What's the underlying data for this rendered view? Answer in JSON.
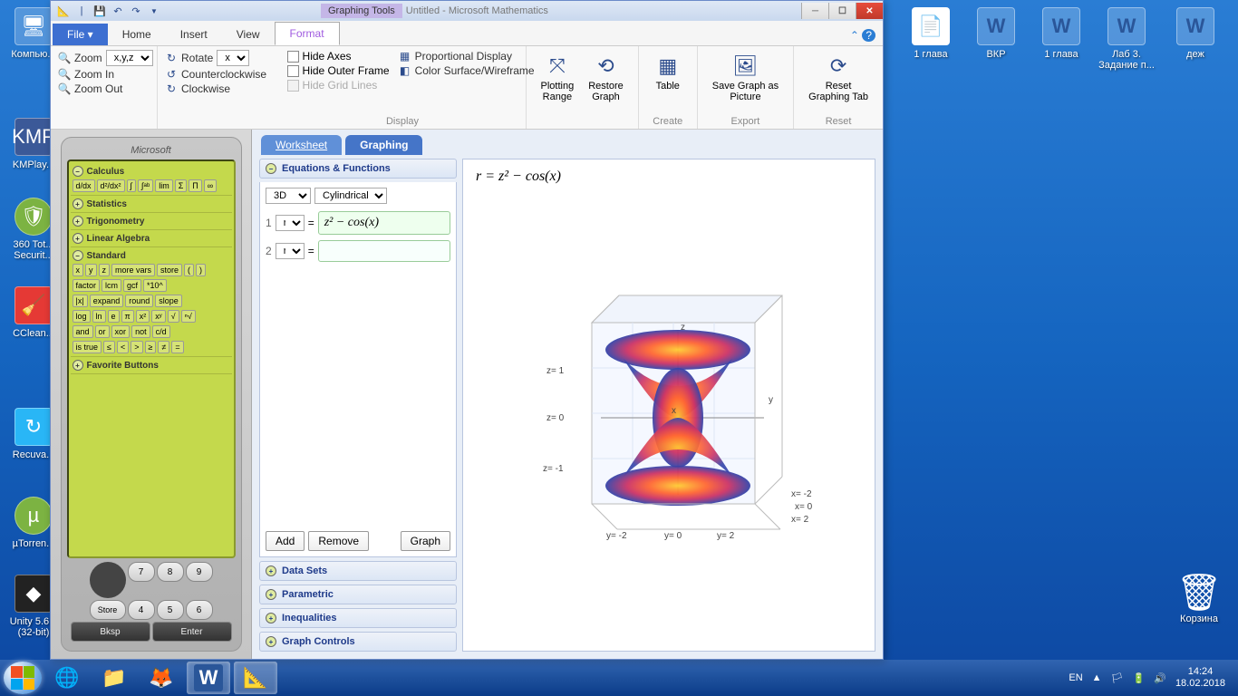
{
  "desktop": {
    "left": [
      {
        "label": "Компью..."
      },
      {
        "label": "KMPlay..."
      },
      {
        "label": "360 Tot...\nSecurit..."
      },
      {
        "label": "CClean..."
      },
      {
        "label": "Recuva..."
      },
      {
        "label": "µTorren..."
      },
      {
        "label": "Unity 5.6...\n(32-bit)"
      }
    ],
    "right": [
      {
        "label": "1 глава"
      },
      {
        "label": "ВКР"
      },
      {
        "label": "1 глава"
      },
      {
        "label": "Лаб 3.\nЗадание п..."
      },
      {
        "label": "деж"
      }
    ],
    "trash": "Корзина"
  },
  "window": {
    "contextual_tab": "Graphing Tools",
    "title": "Untitled - Microsoft Mathematics",
    "menu": {
      "file": "File",
      "home": "Home",
      "insert": "Insert",
      "view": "View",
      "format": "Format"
    },
    "ribbon": {
      "zoom": {
        "label": "Zoom",
        "value": "x,y,z",
        "in": "Zoom In",
        "out": "Zoom Out"
      },
      "rotate": {
        "label": "Rotate",
        "value": "x",
        "ccw": "Counterclockwise",
        "cw": "Clockwise"
      },
      "display": {
        "group": "Display",
        "hideaxes": "Hide Axes",
        "hideouter": "Hide Outer Frame",
        "hidegrid": "Hide Grid Lines",
        "prop": "Proportional Display",
        "color": "Color Surface/Wireframe"
      },
      "range": {
        "label": "Plotting\nRange",
        "group": ""
      },
      "restore": {
        "label": "Restore\nGraph"
      },
      "table": {
        "label": "Table",
        "group": "Create"
      },
      "export": {
        "label": "Save Graph as\nPicture",
        "group": "Export"
      },
      "reset": {
        "label": "Reset\nGraphing Tab",
        "group": "Reset"
      }
    },
    "subtabs": {
      "worksheet": "Worksheet",
      "graphing": "Graphing"
    },
    "accordion": {
      "eq": "Equations & Functions",
      "dim": "3D",
      "coord": "Cylindrical",
      "row1var": "r",
      "row1expr": "z² − cos(x)",
      "row2var": "r",
      "row2expr": "",
      "add": "Add",
      "remove": "Remove",
      "graph": "Graph",
      "datasets": "Data Sets",
      "parametric": "Parametric",
      "ineq": "Inequalities",
      "controls": "Graph Controls"
    },
    "formula": "r = z² − cos(x)",
    "axis": {
      "z1": "z= 1",
      "z0": "z= 0",
      "zm1": "z= -1",
      "ym2": "y= -2",
      "y0": "y= 0",
      "y2": "y= 2",
      "xm2": "x= -2",
      "x0": "x= 0",
      "x2": "x= 2",
      "ylab": "y",
      "zlab": "z",
      "xlab": "x"
    }
  },
  "calc": {
    "brand": "Microsoft",
    "sections": {
      "calculus": "Calculus",
      "calc_btns": [
        "d/dx",
        "d²/dx²",
        "∫",
        "∫ᵃᵇ",
        "lim",
        "Σ",
        "Π",
        "∞"
      ],
      "stats": "Statistics",
      "trig": "Trigonometry",
      "linalg": "Linear Algebra",
      "standard": "Standard",
      "std_row1": [
        "x",
        "y",
        "z",
        "more vars",
        "store",
        "(",
        ")"
      ],
      "std_row2": [
        "factor",
        "lcm",
        "gcf",
        "*10^"
      ],
      "std_row3": [
        "|x|",
        "expand",
        "round",
        "slope"
      ],
      "std_row4": [
        "log",
        "ln",
        "e",
        "π",
        "x²",
        "xʸ",
        "√",
        "ⁿ√"
      ],
      "std_row5": [
        "and",
        "or",
        "xor",
        "not",
        "c/d"
      ],
      "std_row6": [
        "is true",
        "≤",
        "<",
        ">",
        "≥",
        "≠",
        "="
      ],
      "fav": "Favorite Buttons"
    },
    "keypad": {
      "bksp": "Bksp",
      "enter": "Enter",
      "store": "Store"
    }
  },
  "taskbar": {
    "lang": "EN",
    "time": "14:24",
    "date": "18.02.2018"
  }
}
